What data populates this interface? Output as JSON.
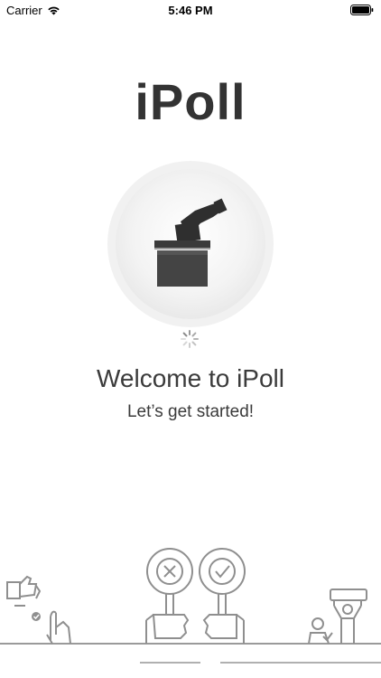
{
  "status_bar": {
    "carrier": "Carrier",
    "time": "5:46 PM",
    "wifi_icon": "wifi-icon",
    "battery_icon": "battery-icon"
  },
  "app": {
    "title": "iPoll"
  },
  "hero": {
    "icon": "ballot-box-icon",
    "loading_icon": "spinner-icon"
  },
  "welcome": {
    "heading": "Welcome to iPoll",
    "subheading": "Let’s get started!"
  },
  "illustration": {
    "left_icon": "thumbs-hand-icon",
    "center_icons": [
      "reject-sign-icon",
      "approve-sign-icon"
    ],
    "right_icon": "voters-icon"
  }
}
